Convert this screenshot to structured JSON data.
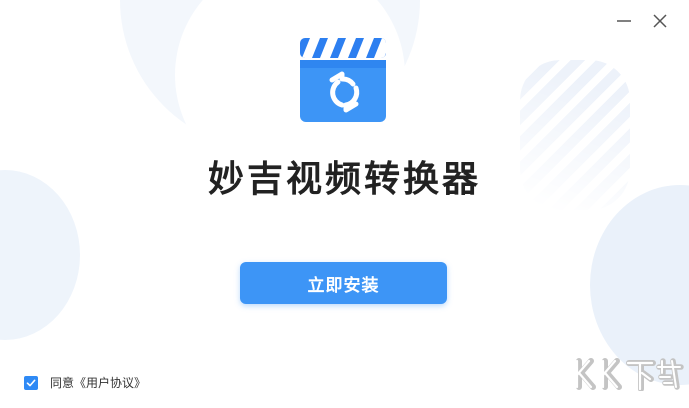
{
  "window": {
    "minimize_icon": "minimize-icon",
    "close_icon": "close-icon"
  },
  "app": {
    "logo_icon": "video-clapper-convert-icon",
    "title": "妙吉视频转换器"
  },
  "install": {
    "button_label": "立即安装"
  },
  "agreement": {
    "checked": true,
    "prefix": "同意",
    "link": "《用户协议》"
  },
  "watermark": {
    "text": "KK下载"
  },
  "colors": {
    "accent": "#3d95f6",
    "title": "#222222",
    "checkbox": "#2f8af5"
  }
}
